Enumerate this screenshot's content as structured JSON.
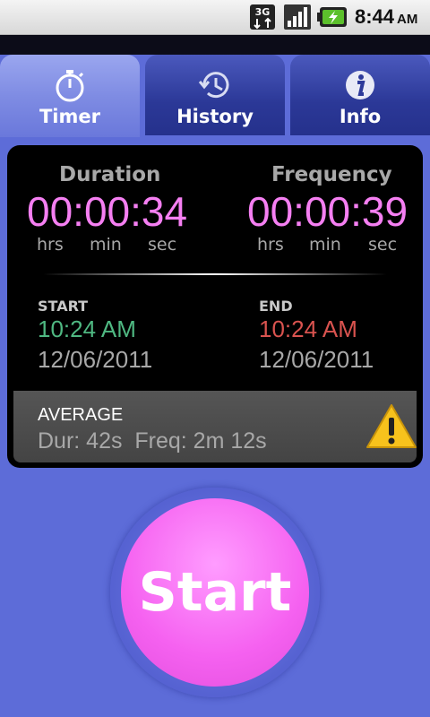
{
  "status_bar": {
    "network": "3G",
    "time": "8:44",
    "ampm": "AM"
  },
  "tabs": [
    {
      "label": "Timer",
      "icon": "stopwatch-icon",
      "active": true
    },
    {
      "label": "History",
      "icon": "history-icon",
      "active": false
    },
    {
      "label": "Info",
      "icon": "info-icon",
      "active": false
    }
  ],
  "timer": {
    "duration": {
      "label": "Duration",
      "value": "00:00:34"
    },
    "frequency": {
      "label": "Frequency",
      "value": "00:00:39"
    },
    "units": [
      "hrs",
      "min",
      "sec"
    ],
    "start": {
      "label": "START",
      "time": "10:24 AM",
      "date": "12/06/2011"
    },
    "end": {
      "label": "END",
      "time": "10:24 AM",
      "date": "12/06/2011"
    }
  },
  "average": {
    "label": "AVERAGE",
    "values": "Dur: 42s  Freq: 2m 12s",
    "icon": "warning-icon"
  },
  "start_button": {
    "label": "Start"
  },
  "colors": {
    "background": "#5d6cd8",
    "timer_pink": "#f57ff2",
    "start_green": "#4fb882",
    "end_red": "#d9534f",
    "button_pink": "#f561f0"
  }
}
